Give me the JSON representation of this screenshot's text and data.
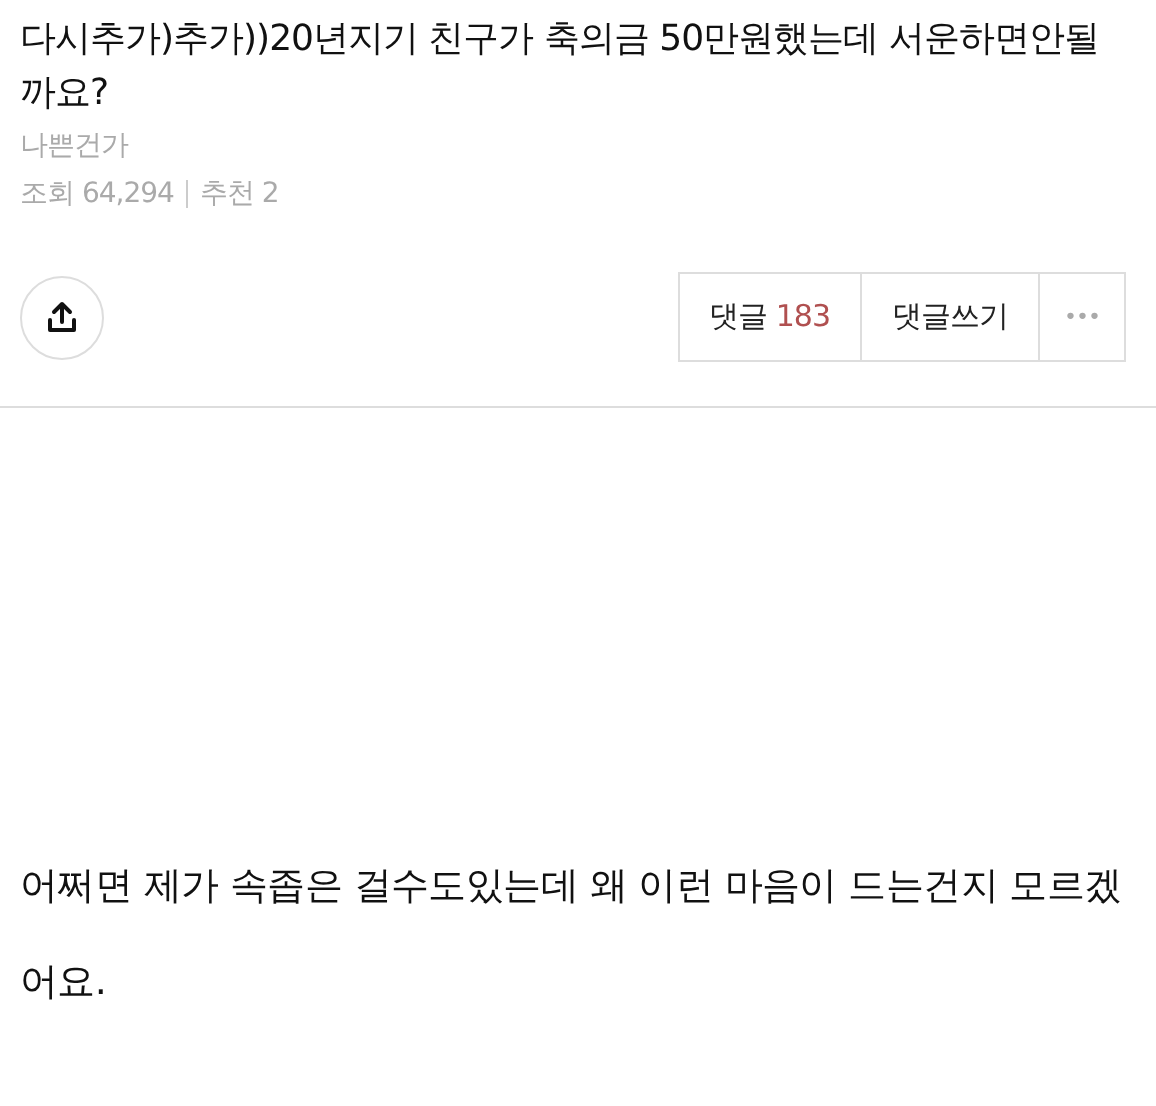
{
  "post": {
    "title": "다시추가)추가))20년지기 친구가 축의금 50만원했는데 서운하면안될까요?",
    "author": "나쁜건가",
    "views": "조회 64,294",
    "recommends": "추천 2"
  },
  "actions": {
    "comment_label": "댓글",
    "comment_count": "183",
    "write_comment": "댓글쓰기",
    "more": "•••"
  },
  "body": [
    "어쩌면 제가 속좁은 걸수도있는데 왜 이런 마음이 드는건지 모르겠어요."
  ]
}
